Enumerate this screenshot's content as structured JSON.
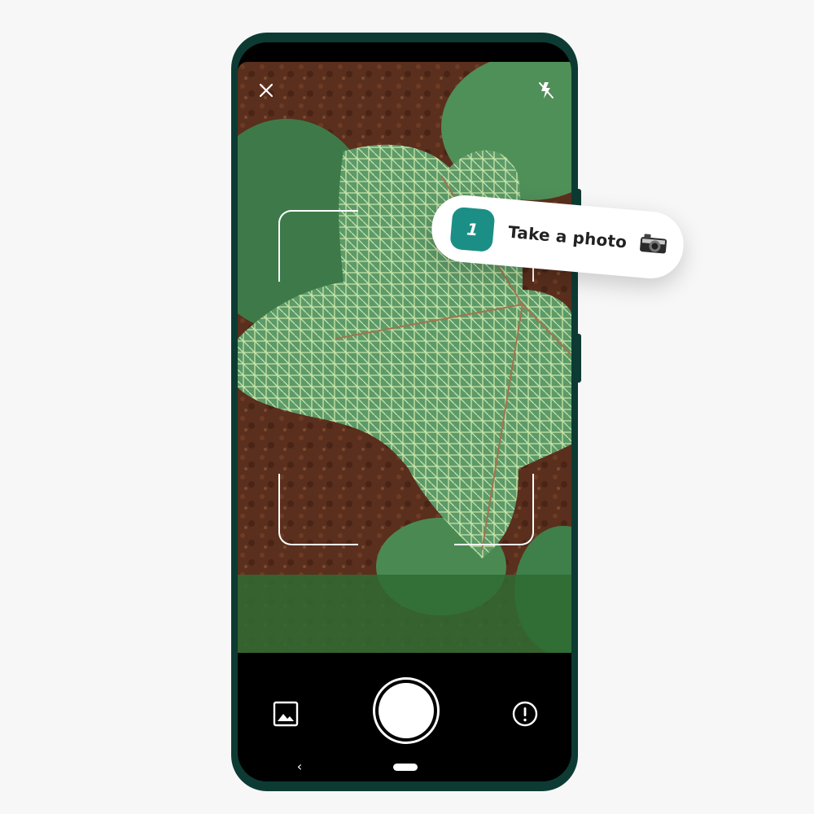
{
  "callout": {
    "step_number": "1",
    "text": "Take a photo"
  },
  "nav": {
    "back_glyph": "‹"
  },
  "icons": {
    "close": "close-icon",
    "flash": "flash-off-icon",
    "gallery": "gallery-icon",
    "shutter": "shutter-button",
    "info": "info-icon",
    "camera": "camera-icon"
  },
  "colors": {
    "phone_frame": "#0d3b34",
    "accent": "#1b8f86",
    "background": "#f7f7f7"
  }
}
